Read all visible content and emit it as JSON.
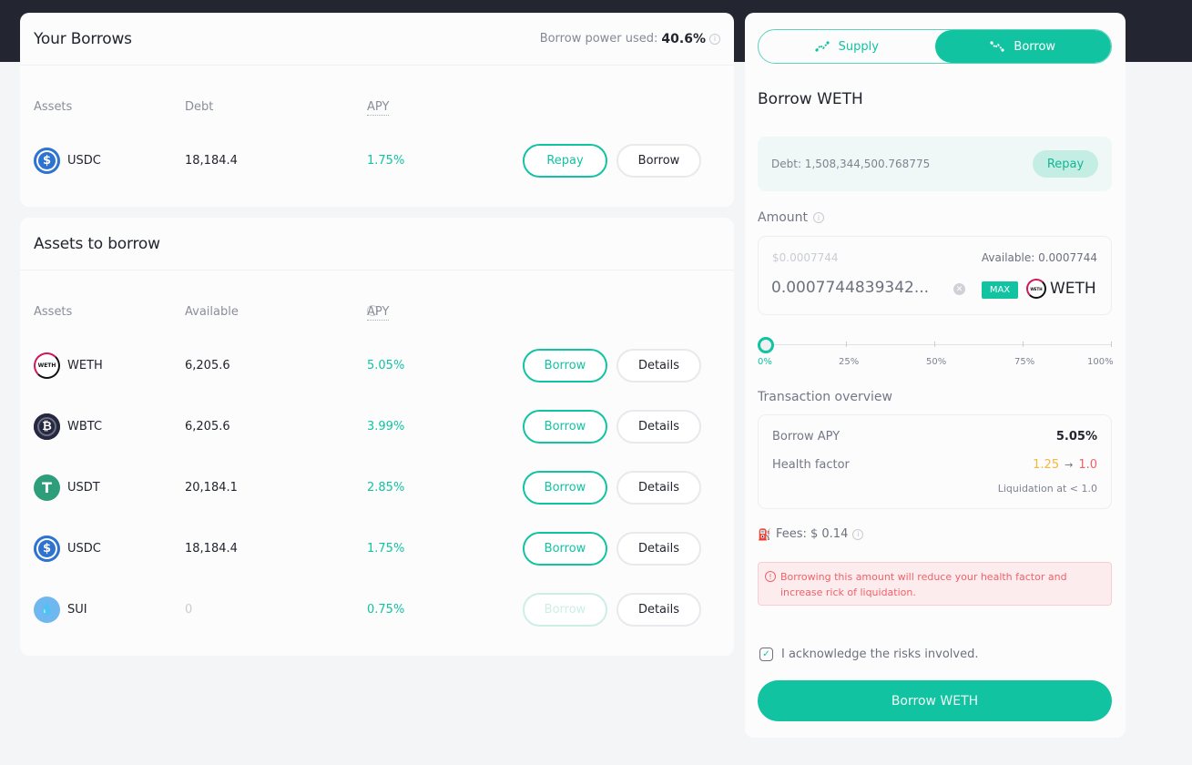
{
  "your_borrows": {
    "title": "Your Borrows",
    "power_label": "Borrow power used:",
    "power_value": "40.6%",
    "columns": [
      "Assets",
      "Debt",
      "APY"
    ],
    "rows": [
      {
        "icon": "usdc-icon",
        "symbol": "USDC",
        "debt": "18,184.4",
        "apy": "1.75%",
        "primary": "Repay",
        "secondary": "Borrow"
      }
    ]
  },
  "assets_to_borrow": {
    "title": "Assets to borrow",
    "columns": [
      "Assets",
      "Available",
      "APY"
    ],
    "rows": [
      {
        "icon": "weth-icon",
        "symbol": "WETH",
        "available": "6,205.6",
        "apy": "5.05%",
        "primary": "Borrow",
        "secondary": "Details",
        "disabled": false
      },
      {
        "icon": "wbtc-icon",
        "symbol": "WBTC",
        "available": "6,205.6",
        "apy": "3.99%",
        "primary": "Borrow",
        "secondary": "Details",
        "disabled": false
      },
      {
        "icon": "usdt-icon",
        "symbol": "USDT",
        "available": "20,184.1",
        "apy": "2.85%",
        "primary": "Borrow",
        "secondary": "Details",
        "disabled": false
      },
      {
        "icon": "usdc-icon",
        "symbol": "USDC",
        "available": "18,184.4",
        "apy": "1.75%",
        "primary": "Borrow",
        "secondary": "Details",
        "disabled": false
      },
      {
        "icon": "sui-icon",
        "symbol": "SUI",
        "available": "0",
        "apy": "0.75%",
        "primary": "Borrow",
        "secondary": "Details",
        "disabled": true
      }
    ]
  },
  "panel": {
    "tabs": [
      {
        "label": "Supply",
        "icon": "supply-trend-icon",
        "active": false
      },
      {
        "label": "Borrow",
        "icon": "borrow-trend-icon",
        "active": true
      }
    ],
    "title": "Borrow WETH",
    "debt_text": "Debt: 1,508,344,500.768775",
    "repay_label": "Repay",
    "amount_label": "Amount",
    "usd_value": "$0.0007744",
    "available_text": "Available: 0.0007744",
    "amount_value": "0.0007744839342...",
    "max_label": "MAX",
    "token": "WETH",
    "slider": {
      "value_percent": 0,
      "labels": [
        "0%",
        "25%",
        "50%",
        "75%",
        "100%"
      ]
    },
    "tx_label": "Transaction overview",
    "borrow_apy_label": "Borrow APY",
    "borrow_apy_value": "5.05%",
    "health_label": "Health factor",
    "health_from": "1.25",
    "health_to": "1.0",
    "liquidation_text": "Liquidation at < 1.0",
    "fees_text": "Fees: $ 0.14",
    "warning": "Borrowing this amount will reduce your health factor and increase rick of liquidation.",
    "ack_text": "I acknowledge the risks involved.",
    "ack_checked": true,
    "cta_label": "Borrow WETH"
  },
  "colors": {
    "accent": "#12c3a2",
    "danger": "#f0616a",
    "warning": "#f4b63b",
    "header": "#232630"
  }
}
